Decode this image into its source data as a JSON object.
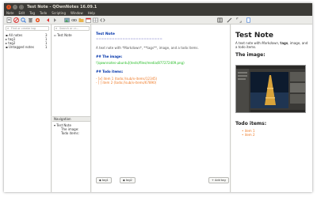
{
  "window": {
    "title": "Test Note - QOwnNotes 16.09.1",
    "close_glyph": "×",
    "min_glyph": "–",
    "max_glyph": "□"
  },
  "menu": [
    "Note",
    "Edit",
    "Tag",
    "Todo",
    "Scripting",
    "Window",
    "Help"
  ],
  "tags_panel": {
    "search_placeholder": "Find or create tag",
    "items": [
      {
        "label": "All notes",
        "count": "3"
      },
      {
        "label": "tag1",
        "count": "1"
      },
      {
        "label": "tag2",
        "count": "1"
      },
      {
        "label": "Untagged notes",
        "count": "1"
      }
    ]
  },
  "notes_panel": {
    "search_placeholder": "Search or cr...",
    "notes": [
      "Test Note"
    ]
  },
  "navigation": {
    "header": "Navigation",
    "items": [
      "Test Note",
      "The image:",
      "Todo items:"
    ]
  },
  "editor": {
    "title": "Test Note",
    "underline": "=========================",
    "body": "A text note with *Markdown*, **tags**, image, and a todo items.",
    "image_heading": "## The image:",
    "image_link": "![qownnotes-ubuntu](tests/files/media/877272409.png)",
    "todo_heading": "## Todo items:",
    "todo_items": [
      "- [x] item 1 (todo://sub/x-items/12345)",
      "- [ ] item 2 (todo://sub/x-items/67890)"
    ],
    "tag_buttons": [
      "tag1",
      "tag2"
    ],
    "add_tag": "Add tag"
  },
  "preview": {
    "title": "Test Note",
    "body_prefix": "A text note with ",
    "body_markdown": "Markdown",
    "body_comma": ", ",
    "body_tags": "tags",
    "body_suffix": ", image, and a todo items.",
    "image_heading": "The image:",
    "todo_heading": "Todo items:",
    "todo_items": [
      "item 1",
      "item 2"
    ]
  },
  "toolbar_icons": [
    "new-note-icon",
    "remove-note-icon",
    "search-icon",
    "trash-icon",
    "settings-icon",
    "back-icon",
    "forward-icon",
    "insert-image-icon",
    "insert-link-icon",
    "folder-icon",
    "calendar-icon",
    "table-icon",
    "code-icon",
    "toggle-layout-icon",
    "edit-mode-icon",
    "fullscreen-icon",
    "distraction-free-icon"
  ],
  "colors": {
    "titlebar": "#3c3b37",
    "accent": "#e95420",
    "selection": "#5294e2",
    "heading_blue": "#0033aa",
    "link_green": "#22bb22",
    "todo_orange": "#ee7722"
  }
}
